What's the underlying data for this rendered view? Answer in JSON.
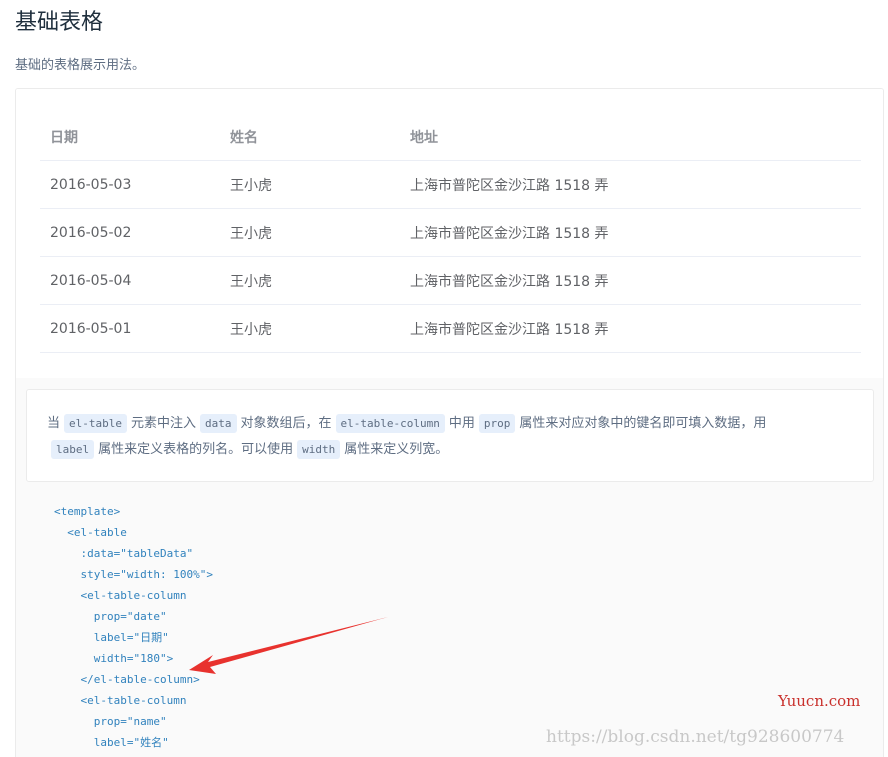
{
  "page": {
    "title": "基础表格",
    "description": "基础的表格展示用法。"
  },
  "table": {
    "columns": [
      "日期",
      "姓名",
      "地址"
    ],
    "rows": [
      [
        "2016-05-03",
        "王小虎",
        "上海市普陀区金沙江路 1518 弄"
      ],
      [
        "2016-05-02",
        "王小虎",
        "上海市普陀区金沙江路 1518 弄"
      ],
      [
        "2016-05-04",
        "王小虎",
        "上海市普陀区金沙江路 1518 弄"
      ],
      [
        "2016-05-01",
        "王小虎",
        "上海市普陀区金沙江路 1518 弄"
      ]
    ]
  },
  "doc": {
    "p1": "当",
    "code1": "el-table",
    "p2": "元素中注入",
    "code2": "data",
    "p3": "对象数组后，在",
    "code3": "el-table-column",
    "p4": "中用",
    "code4": "prop",
    "p5": "属性来对应对象中的键名即可填入数据，用",
    "code5": "label",
    "p6": "属性来定义表格的列名。可以使用",
    "code6": "width",
    "p7": "属性来定义列宽。"
  },
  "code": {
    "lines": [
      "<template>",
      "  <el-table",
      "    :data=\"tableData\"",
      "    style=\"width: 100%\">",
      "    <el-table-column",
      "      prop=\"date\"",
      "      label=\"日期\"",
      "      width=\"180\">",
      "    </el-table-column>",
      "    <el-table-column",
      "      prop=\"name\"",
      "      label=\"姓名\""
    ]
  },
  "watermark": {
    "brand": "Yuucn.com",
    "url": "https://blog.csdn.net/tg928600774"
  },
  "colors": {
    "arrow": "#e8322e",
    "code_text": "#3182bd",
    "inline_code_bg": "#e6effb"
  }
}
